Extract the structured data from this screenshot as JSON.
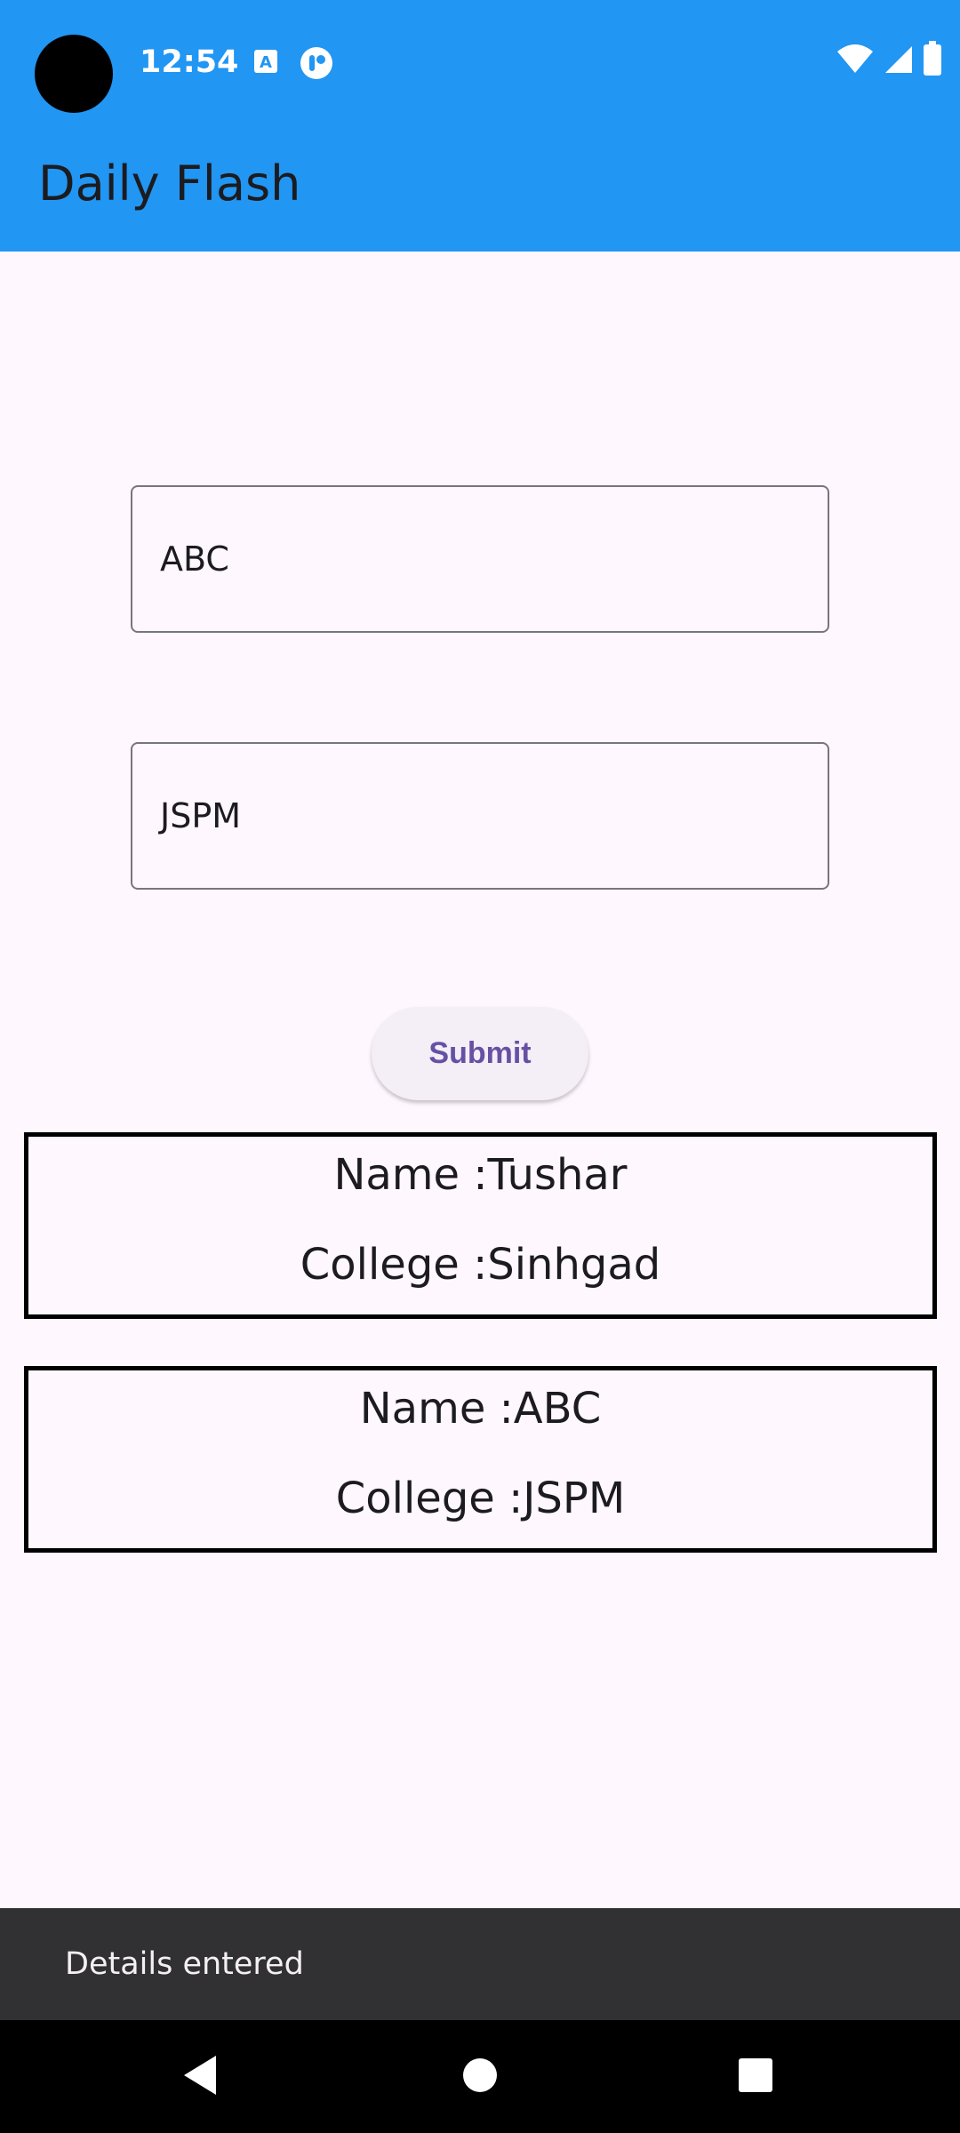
{
  "status_bar": {
    "time": "12:54",
    "icons_left": [
      "text-notification-icon",
      "app-notification-icon"
    ],
    "icons_right": [
      "wifi-icon",
      "cell-signal-icon",
      "battery-icon"
    ]
  },
  "app_bar": {
    "title": "Daily Flash"
  },
  "form": {
    "name_field_value": "ABC",
    "college_field_value": "JSPM",
    "submit_label": "Submit"
  },
  "entries": [
    {
      "name_line": "Name :Tushar",
      "college_line": "College :Sinhgad"
    },
    {
      "name_line": "Name :ABC",
      "college_line": "College :JSPM"
    }
  ],
  "snackbar": {
    "message": "Details entered"
  },
  "nav_bar": {
    "buttons": [
      "back-icon",
      "home-icon",
      "recents-icon"
    ]
  },
  "colors": {
    "app_bar": "#2196f3",
    "background": "#fef7fd",
    "button_text": "#6750a4",
    "snackbar": "#313033"
  }
}
